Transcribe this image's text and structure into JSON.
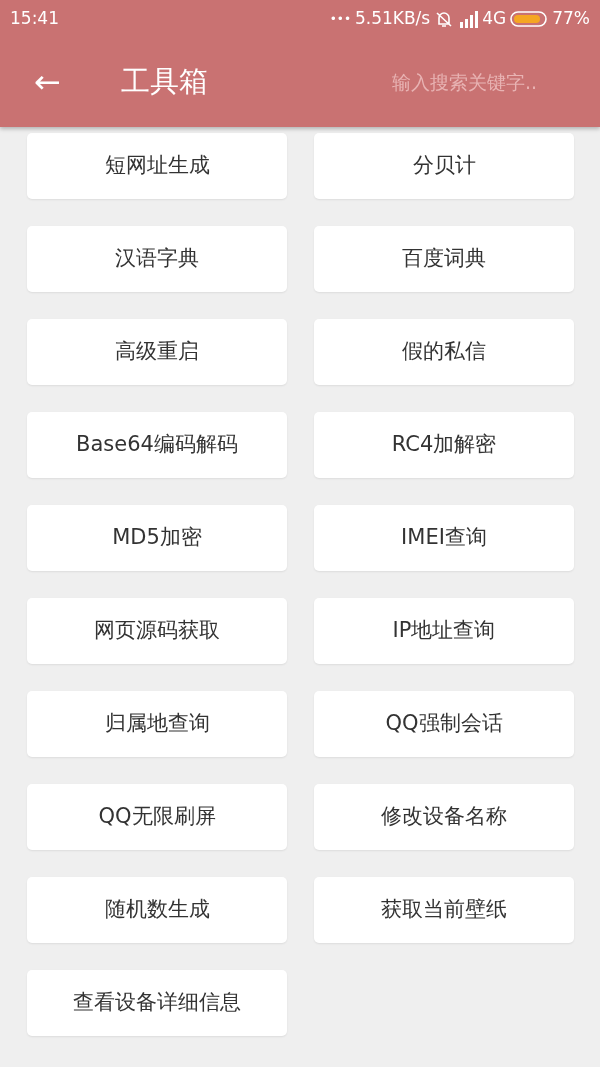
{
  "status_bar": {
    "time": "15:41",
    "dots": "•••",
    "speed": "5.51KB/s",
    "network": "4G",
    "battery": "77%"
  },
  "app_bar": {
    "back": "←",
    "title": "工具箱",
    "search": {
      "placeholder": "输入搜索关键字.."
    }
  },
  "tools": [
    "短网址生成",
    "分贝计",
    "汉语字典",
    "百度词典",
    "高级重启",
    "假的私信",
    "Base64编码解码",
    "RC4加解密",
    "MD5加密",
    "IMEI查询",
    "网页源码获取",
    "IP地址查询",
    "归属地查询",
    "QQ强制会话",
    "QQ无限刷屏",
    "修改设备名称",
    "随机数生成",
    "获取当前壁纸",
    "查看设备详细信息"
  ]
}
